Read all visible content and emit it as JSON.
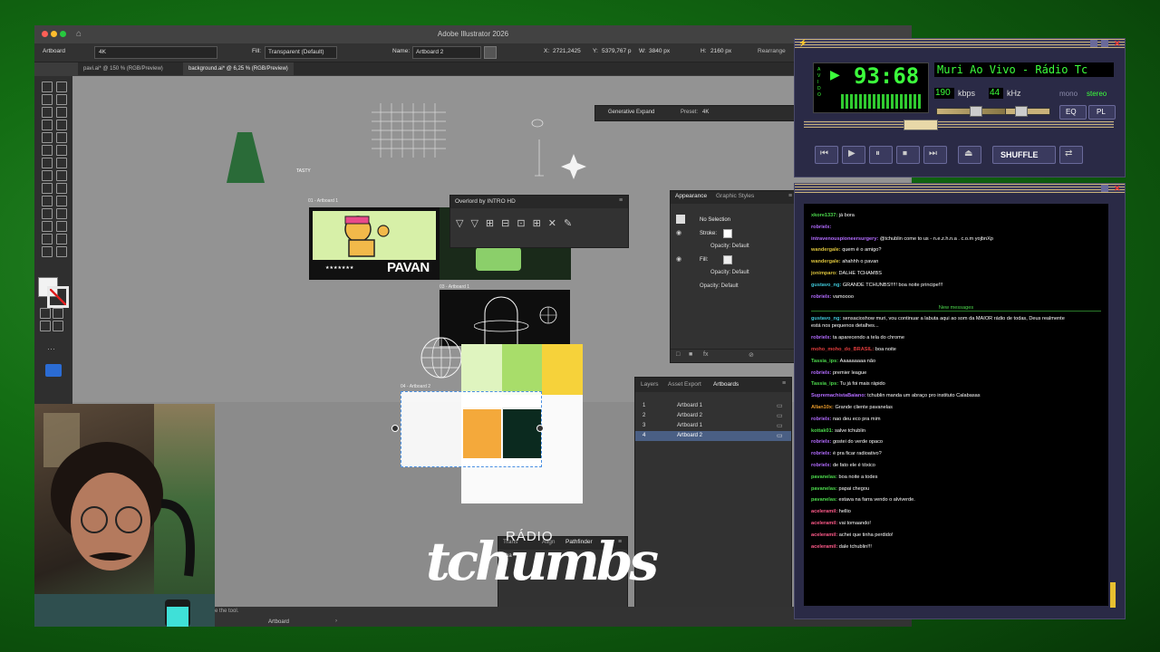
{
  "app": {
    "title": "Adobe Illustrator 2026",
    "control": {
      "selection_type": "Artboard",
      "preset": "4K",
      "fill_label": "Fill:",
      "fill_value": "Transparent (Default)",
      "name_label": "Name:",
      "name_value": "Artboard 2",
      "x_label": "X:",
      "x_value": "2721,2425",
      "y_label": "Y:",
      "y_value": "5379,767 p",
      "w_label": "W:",
      "w_value": "3840 px",
      "h_label": "H:",
      "h_value": "2160 px",
      "rearrange": "Rearrange"
    },
    "tabs": [
      {
        "label": "pavi.ai* @ 150 % (RGB/Preview)"
      },
      {
        "label": "background.ai* @ 6,25 % (RGB/Preview)"
      }
    ],
    "contextual_bar": {
      "generative_expand": "Generative Expand",
      "preset_label": "Preset:",
      "preset_value": "4K"
    },
    "overlord": {
      "title": "Overlord by INTRO HD"
    },
    "appearance": {
      "tabs": [
        "Appearance",
        "Graphic Styles"
      ],
      "selection": "No Selection",
      "stroke": "Stroke:",
      "fill": "Fill:",
      "opacity_rows": [
        "Opacity: Default",
        "Opacity: Default",
        "Opacity: Default"
      ]
    },
    "layers_panel": {
      "tabs": [
        "Layers",
        "Asset Export",
        "Artboards"
      ],
      "rows": [
        {
          "num": "1",
          "name": "Artboard 1"
        },
        {
          "num": "2",
          "name": "Artboard 2"
        },
        {
          "num": "3",
          "name": "Artboard 1"
        },
        {
          "num": "4",
          "name": "Artboard 2"
        }
      ]
    },
    "align_panel": {
      "tabs": [
        "Trans",
        "Align",
        "Pathfinder"
      ],
      "shape_label": "Sha"
    },
    "artboard_labels": {
      "ab1": "01 - Artboard 1",
      "ab2": "03 - Artboard 1",
      "ab3": "04 - Artboard 2"
    },
    "artwork": {
      "pavan": "PAVAN",
      "stars": "★★★★★★★",
      "small_sign": "TASTY"
    },
    "status": {
      "hint": "se the tool.",
      "artboard": "Artboard"
    }
  },
  "overlay_logo": {
    "top": "RÁDIO",
    "main": "tchumbs"
  },
  "winamp": {
    "time": "93:68",
    "title": "Muri Ao Vivo - Rádio Tc",
    "bitrate": "190",
    "kbps": "kbps",
    "khz_value": "44",
    "khz": "kHz",
    "mono": "mono",
    "stereo": "stereo",
    "eq": "EQ",
    "pl": "PL",
    "shuffle": "SHUFFLE",
    "vis_label": "A V I D O"
  },
  "chat": {
    "new_messages": "New messages",
    "messages": [
      {
        "nick": "xkore1337",
        "color": "#4cd84c",
        "text": "já bora"
      },
      {
        "nick": "robrielx",
        "color": "#b36bff",
        "text": ""
      },
      {
        "nick": "intravenouspioneersurgery",
        "color": "#b36bff",
        "text": "@tchublin come to us - n.e.z.h.n.a . c.o.m yojbnXp"
      },
      {
        "nick": "wandergale",
        "color": "#d9c13b",
        "text": "quem é o amigo?"
      },
      {
        "nick": "wandergale",
        "color": "#d9c13b",
        "text": "ahahhh o pavan"
      },
      {
        "nick": "jonimparo",
        "color": "#d9c13b",
        "text": "DALHE TCHAMBS"
      },
      {
        "nick": "gustavo_ng",
        "color": "#3fc7d8",
        "text": "GRANDE TCHUNBS!!!!! boa noite principe!!!"
      },
      {
        "nick": "robrielx",
        "color": "#b36bff",
        "text": "vamoooo"
      },
      {
        "nick": "gustavo_ng",
        "color": "#3fc7d8",
        "text": "sensacioshow muri, vou continuar a labuta aqui ao som da MAIOR rádio de todas, Deus realmente"
      },
      {
        "nick": "",
        "color": "#ffffff",
        "text": "está nos pequenos detalhes..."
      },
      {
        "nick": "robrielx",
        "color": "#b36bff",
        "text": "ta aparecendo a tela do chrome"
      },
      {
        "nick": "moho_moho_do_BRASIL",
        "color": "#e03c3c",
        "text": "boa noite"
      },
      {
        "nick": "Tassia_ips",
        "color": "#4cd84c",
        "text": "Aaaaaaaaa não"
      },
      {
        "nick": "robrielx",
        "color": "#b36bff",
        "text": "premier league"
      },
      {
        "nick": "Tassia_ips",
        "color": "#4cd84c",
        "text": "Tu já foi mais rápido"
      },
      {
        "nick": "SupremachistaBaiano",
        "color": "#b36bff",
        "text": "tchublin manda um abraço pro instituto Calabasas"
      },
      {
        "nick": "Allan10x",
        "color": "#e89a2a",
        "text": "Grande cliente pavanelas"
      },
      {
        "nick": "robrielx",
        "color": "#b36bff",
        "text": "nao deu eco pra mim"
      },
      {
        "nick": "kottak01",
        "color": "#4cd84c",
        "text": "salve tchublin"
      },
      {
        "nick": "robrielx",
        "color": "#b36bff",
        "text": "gostei do verde opaco"
      },
      {
        "nick": "robrielx",
        "color": "#b36bff",
        "text": "é pra ficar radioativo?"
      },
      {
        "nick": "robrielx",
        "color": "#b36bff",
        "text": "de fato ele é tóxico"
      },
      {
        "nick": "pavanelas",
        "color": "#4cd84c",
        "text": "boa noite a todes"
      },
      {
        "nick": "pavanelas",
        "color": "#4cd84c",
        "text": "papai chegou"
      },
      {
        "nick": "pavanelas",
        "color": "#4cd84c",
        "text": "estava na farra vendo o alviverde."
      },
      {
        "nick": "aceleramil",
        "color": "#ff5a8a",
        "text": "hellio"
      },
      {
        "nick": "aceleramil",
        "color": "#ff5a8a",
        "text": "vai tomaando!"
      },
      {
        "nick": "aceleramil",
        "color": "#ff5a8a",
        "text": "achei que tinha perdido!"
      },
      {
        "nick": "aceleramil",
        "color": "#ff5a8a",
        "text": "dale tchublin!!!"
      }
    ]
  },
  "colors": {
    "accent": "#2b6cd4",
    "winamp_green": "#3cff3c",
    "swatch_orange": "#f4a93b",
    "swatch_darkgreen": "#0b2a1f",
    "swatch_lime": "#a8dd6a",
    "swatch_yellow": "#f6d23a"
  }
}
